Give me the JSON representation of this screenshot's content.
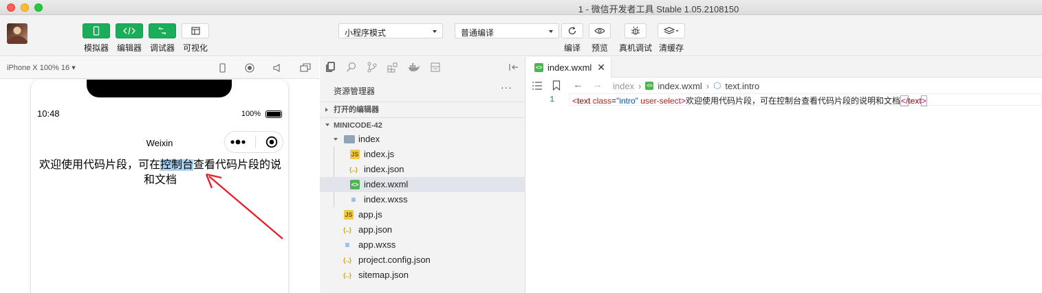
{
  "window": {
    "title": "1 - 微信开发者工具 Stable 1.05.2108150"
  },
  "toolbar": {
    "left_buttons": [
      {
        "label": "模拟器",
        "icon": "phone-icon"
      },
      {
        "label": "编辑器",
        "icon": "code-icon"
      },
      {
        "label": "调试器",
        "icon": "debug-toggle-icon"
      },
      {
        "label": "可视化",
        "icon": "layout-icon"
      }
    ],
    "mode_select": "小程序模式",
    "compile_select": "普通编译",
    "right_buttons": [
      {
        "label": "编译",
        "icon": "refresh-icon"
      },
      {
        "label": "预览",
        "icon": "eye-icon"
      },
      {
        "label": "真机调试",
        "icon": "bug-icon"
      },
      {
        "label": "清缓存",
        "icon": "layers-icon"
      }
    ]
  },
  "simulator": {
    "device": "iPhone X 100% 16",
    "status": {
      "time": "10:48",
      "battery": "100%"
    },
    "nav_title": "Weixin",
    "content": {
      "before": "欢迎使用代码片段，可在",
      "highlight": "控制台",
      "after": "查看代码片段的说",
      "line2": "和文档"
    },
    "colors": {
      "highlight": "#a8d2f0",
      "arrow": "#e8202a"
    }
  },
  "explorer": {
    "title": "资源管理器",
    "more": "···",
    "open_editors": "打开的编辑器",
    "project": "MINICODE-42",
    "tree": [
      {
        "name": "index",
        "type": "folder",
        "depth": 1
      },
      {
        "name": "index.js",
        "type": "js",
        "depth": 2
      },
      {
        "name": "index.json",
        "type": "json",
        "depth": 2
      },
      {
        "name": "index.wxml",
        "type": "wxml",
        "depth": 2,
        "selected": true
      },
      {
        "name": "index.wxss",
        "type": "wxss",
        "depth": 2
      },
      {
        "name": "app.js",
        "type": "js",
        "depth": 1
      },
      {
        "name": "app.json",
        "type": "json",
        "depth": 1
      },
      {
        "name": "app.wxss",
        "type": "wxss",
        "depth": 1
      },
      {
        "name": "project.config.json",
        "type": "json",
        "depth": 1
      },
      {
        "name": "sitemap.json",
        "type": "json",
        "depth": 1
      }
    ]
  },
  "editor": {
    "tab": "index.wxml",
    "breadcrumb": [
      "index",
      "index.wxml",
      "text.intro"
    ],
    "line_number": "1",
    "code": {
      "open_lt": "<",
      "tag": "text",
      "attr1": "class",
      "eq": "=",
      "val1": "\"intro\"",
      "attr2": "user-select",
      "close_gt": ">",
      "text": "欢迎使用代码片段，可在控制台查看代码片段的说明和文档",
      "end_lt": "</",
      "end_tag": "text",
      "end_gt": ">"
    }
  }
}
